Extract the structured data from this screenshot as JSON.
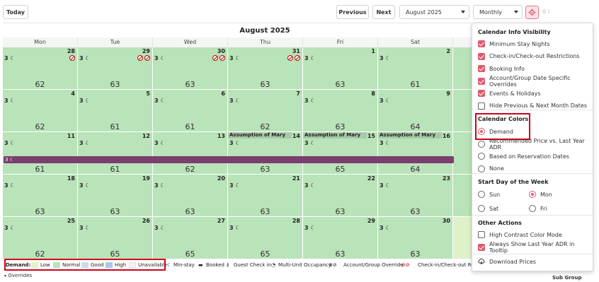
{
  "toolbar": {
    "today": "Today",
    "previous": "Previous",
    "next": "Next",
    "month_select": "August 2025",
    "view_select": "Monthly",
    "right_fragment": "0 I"
  },
  "calendar": {
    "title": "August 2025",
    "weekdays": [
      "Mon",
      "Tue",
      "Wed",
      "Thu",
      "Fri",
      "Sat",
      "Sun"
    ],
    "stay_label": "3",
    "weeks": [
      {
        "days": [
          {
            "day": "28",
            "price": "62"
          },
          {
            "day": "29",
            "price": "63"
          },
          {
            "day": "30",
            "price": "63"
          },
          {
            "day": "31",
            "price": "63"
          },
          {
            "day": "1",
            "price": "63"
          },
          {
            "day": "2",
            "price": "61"
          },
          {
            "day": "3",
            "price": ""
          }
        ]
      },
      {
        "days": [
          {
            "day": "4",
            "price": "62"
          },
          {
            "day": "5",
            "price": "61"
          },
          {
            "day": "6",
            "price": "61"
          },
          {
            "day": "7",
            "price": "62"
          },
          {
            "day": "8",
            "price": "63"
          },
          {
            "day": "9",
            "price": "64"
          },
          {
            "day": "10",
            "price": ""
          }
        ]
      },
      {
        "days": [
          {
            "day": "11",
            "price": "61"
          },
          {
            "day": "12",
            "price": "61"
          },
          {
            "day": "13",
            "price": "62"
          },
          {
            "day": "14",
            "price": "63"
          },
          {
            "day": "15",
            "price": "65"
          },
          {
            "day": "16",
            "price": "64"
          },
          {
            "day": "17",
            "price": ""
          }
        ]
      },
      {
        "days": [
          {
            "day": "18",
            "price": "63"
          },
          {
            "day": "19",
            "price": "63"
          },
          {
            "day": "20",
            "price": "63"
          },
          {
            "day": "21",
            "price": "63"
          },
          {
            "day": "22",
            "price": "63"
          },
          {
            "day": "23",
            "price": "63"
          },
          {
            "day": "24",
            "price": ""
          }
        ]
      },
      {
        "days": [
          {
            "day": "25",
            "price": "62"
          },
          {
            "day": "26",
            "price": "65"
          },
          {
            "day": "27",
            "price": "65"
          },
          {
            "day": "28",
            "price": "65"
          },
          {
            "day": "29",
            "price": "63"
          },
          {
            "day": "30",
            "price": "63"
          },
          {
            "day": "31",
            "price": ""
          }
        ]
      }
    ],
    "event_label": "Assumption of Mary",
    "booking_bar": "3"
  },
  "legend": {
    "demand": "Demand:",
    "low": "Low",
    "normal": "Normal",
    "good": "Good",
    "high": "High",
    "unavailable": "Unavailable",
    "min_stay": "Min-stay",
    "booked": "Booked",
    "guest_checkin": "Guest Check in",
    "multi_unit": "Multi-Unit Occupancy",
    "override": "Account/Group Override",
    "restrictions": "Check-in/Check-out Restr",
    "overrides": "Overrides"
  },
  "colors": {
    "low": "#e3f3c4",
    "normal": "#b9e3b9",
    "good": "#c9dcf5",
    "high": "#a9c8e8",
    "unavailable": "#f3f3f3",
    "accent": "#e05a6d",
    "booking": "#7a3e6f"
  },
  "panel": {
    "info_title": "Calendar Info Visibility",
    "info_items": [
      {
        "label": "Minimum Stay Nights",
        "checked": true
      },
      {
        "label": "Check-in/Check-out Restrictions",
        "checked": true
      },
      {
        "label": "Booking Info",
        "checked": true
      },
      {
        "label": "Account/Group Date Specific Overrides",
        "checked": true
      },
      {
        "label": "Events & Holidays",
        "checked": true
      },
      {
        "label": "Hide Previous & Next Month Dates",
        "checked": false
      }
    ],
    "colors_title": "Calendar Colors",
    "color_options": [
      {
        "label": "Demand",
        "selected": true
      },
      {
        "label": "Recommended Price vs. Last Year ADR",
        "selected": false
      },
      {
        "label": "Based on Reservation Dates",
        "selected": false
      },
      {
        "label": "None",
        "selected": false
      }
    ],
    "start_title": "Start Day of the Week",
    "start_options": [
      "Sun",
      "Mon",
      "Sat",
      "Fri"
    ],
    "start_selected": "Mon",
    "other_title": "Other Actions",
    "other_items": [
      {
        "label": "High Contrast Color Mode",
        "checked": false
      },
      {
        "label": "Always Show Last Year ADR in Tooltip",
        "checked": true
      }
    ],
    "download": "Download Prices"
  },
  "side": {
    "sub_group": "Sub Group"
  }
}
